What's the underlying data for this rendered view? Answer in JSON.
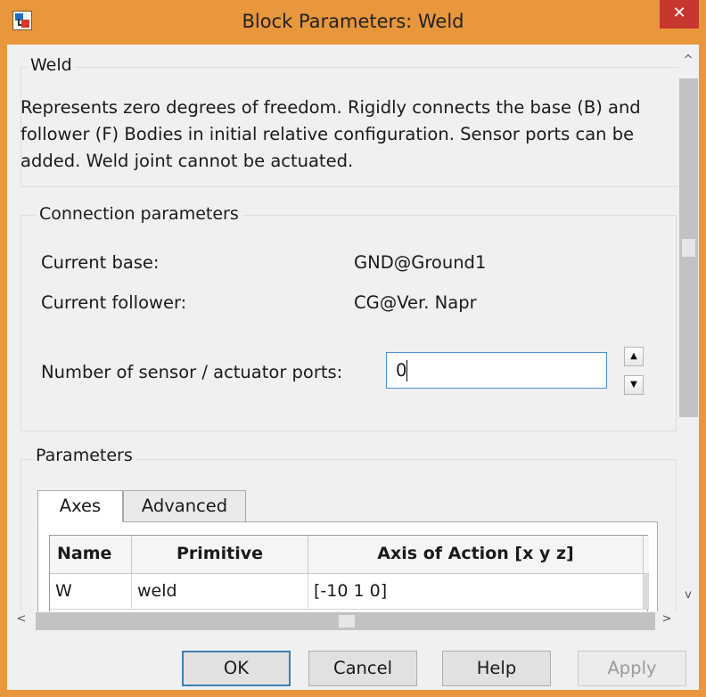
{
  "window": {
    "title": "Block Parameters: Weld",
    "close_glyph": "✕"
  },
  "block": {
    "section_title": "Weld",
    "description": "Represents zero degrees of freedom. Rigidly connects the base (B) and follower (F) Bodies in initial relative configuration. Sensor ports can be added. Weld joint cannot be actuated."
  },
  "connection": {
    "section_title": "Connection parameters",
    "base_label": "Current base:",
    "base_value": "GND@Ground1",
    "follower_label": "Current follower:",
    "follower_value": "CG@Ver. Napr",
    "ports_label": "Number of sensor / actuator ports:",
    "ports_value": "0"
  },
  "parameters": {
    "section_title": "Parameters",
    "tabs": [
      {
        "label": "Axes",
        "active": true
      },
      {
        "label": "Advanced",
        "active": false
      }
    ],
    "table": {
      "headers": [
        "Name",
        "Primitive",
        "Axis of Action [x y z]"
      ],
      "rows": [
        {
          "name": "W",
          "primitive": "weld",
          "axis": "[-10 1 0]"
        }
      ]
    }
  },
  "buttons": {
    "ok": "OK",
    "cancel": "Cancel",
    "help": "Help",
    "apply": "Apply"
  },
  "icons": {
    "app": "simulink-block-icon",
    "spin_up": "▲",
    "spin_down": "▼",
    "scroll_up": "^",
    "scroll_down": "v",
    "scroll_left": "<",
    "scroll_right": ">"
  },
  "colors": {
    "titlebar": "#e8973c",
    "close_button": "#c7372f",
    "input_focus_border": "#4b8fd8",
    "default_button_border": "#3c7fb1"
  }
}
